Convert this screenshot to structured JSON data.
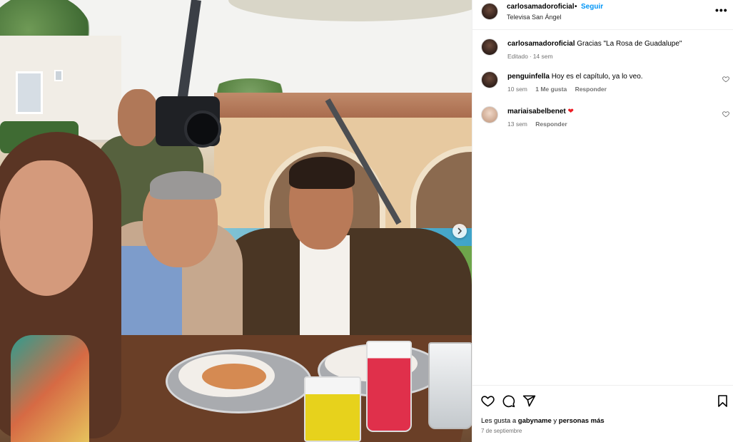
{
  "post": {
    "username": "carlosamadoroficial",
    "separator": "•",
    "follow_label": "Seguir",
    "location": "Televisa San Ángel",
    "more_label": "•••"
  },
  "caption": {
    "username": "carlosamadoroficial",
    "text": "Gracias \"La Rosa de Guadalupe\"",
    "edited": "Editado",
    "dot": "·",
    "time": "14 sem"
  },
  "comments": [
    {
      "username": "penguinfella",
      "text": "Hoy es el capítulo, ya lo veo.",
      "time": "10 sem",
      "likes": "1 Me gusta",
      "reply": "Responder"
    },
    {
      "username": "mariaisabelbenet",
      "text": "",
      "emoji": "❤",
      "time": "13 sem",
      "reply": "Responder"
    }
  ],
  "actions": {
    "icons": [
      "heart-icon",
      "comment-icon",
      "share-icon",
      "bookmark-icon"
    ]
  },
  "likes_line": {
    "prefix": "Les gusta a",
    "user": "gabyname",
    "connector": "y",
    "suffix": "personas más"
  },
  "date": "7 de septiembre",
  "colors": {
    "follow": "#0095f6",
    "meta": "#737373",
    "heart_emoji": "#ed1c24"
  }
}
